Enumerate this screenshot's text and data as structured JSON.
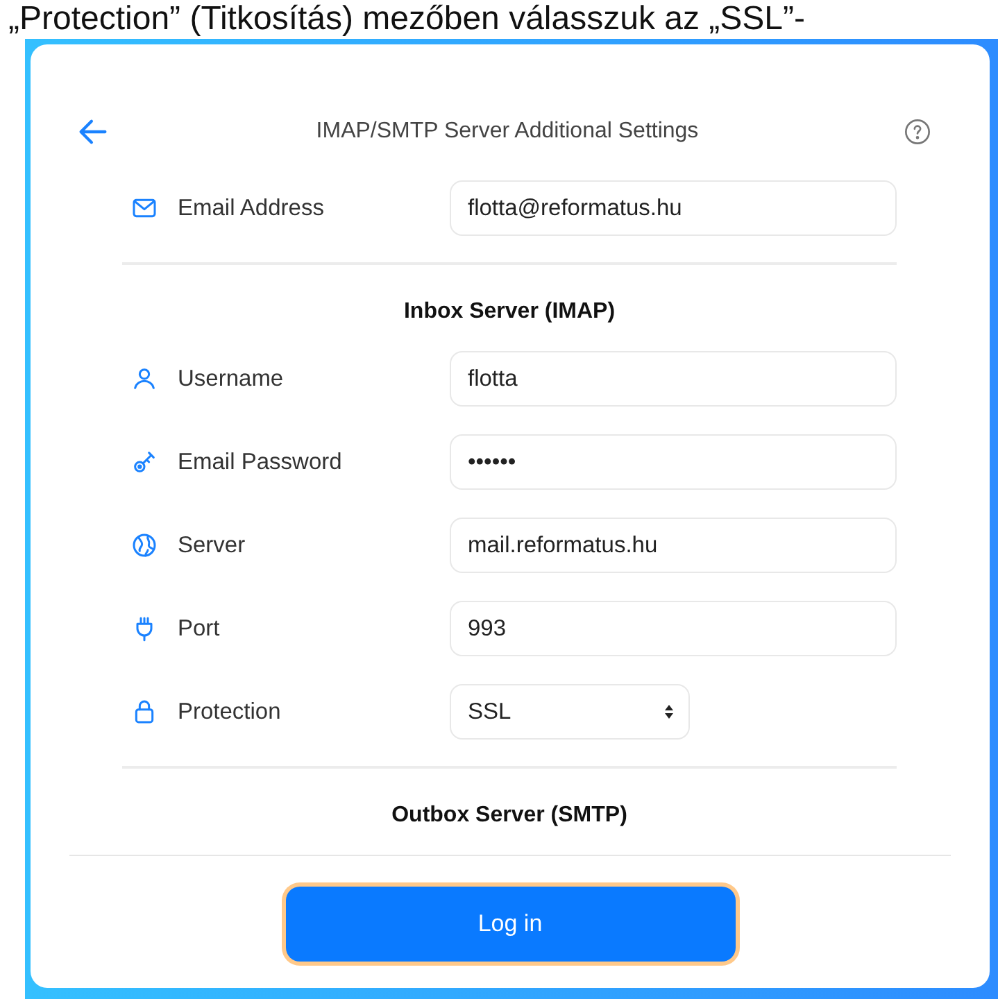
{
  "document_text": "„Protection” (Titkosítás) mezőben válasszuk az „SSL”-",
  "header": {
    "title": "IMAP/SMTP Server Additional Settings"
  },
  "email": {
    "label": "Email Address",
    "value": "flotta@reformatus.hu"
  },
  "sections": [
    {
      "title": "Inbox Server (IMAP)",
      "fields": [
        {
          "kind": "text",
          "label": "Username",
          "value": "flotta"
        },
        {
          "kind": "password",
          "label": "Email Password",
          "value": "••••••"
        },
        {
          "kind": "text",
          "label": "Server",
          "value": "mail.reformatus.hu"
        },
        {
          "kind": "text",
          "label": "Port",
          "value": "993"
        },
        {
          "kind": "select",
          "label": "Protection",
          "value": "SSL"
        }
      ]
    },
    {
      "title": "Outbox Server (SMTP)"
    }
  ],
  "login_button": {
    "label": "Log in",
    "focused": true
  }
}
